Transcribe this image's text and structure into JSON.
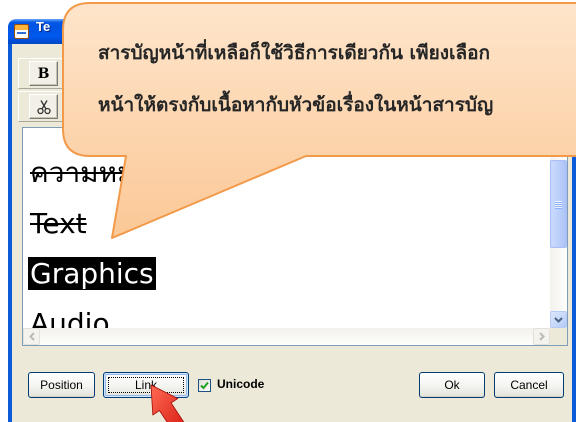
{
  "window": {
    "title": "Te"
  },
  "toolbar": {
    "bold_label": "B"
  },
  "list": {
    "items": [
      {
        "label": "ความหม",
        "struck": true,
        "selected": false
      },
      {
        "label": "Text",
        "struck": true,
        "selected": false
      },
      {
        "label": "Graphics",
        "struck": false,
        "selected": true
      },
      {
        "label": "Audio",
        "struck": false,
        "selected": false
      }
    ]
  },
  "buttons": {
    "position": "Position",
    "link": "Link",
    "ok": "Ok",
    "cancel": "Cancel"
  },
  "unicode": {
    "label": "Unicode",
    "checked": true
  },
  "callout": {
    "line1": "สารบัญหน้าที่เหลือก็ใช้วิธีการเดียวกัน เพียงเลือก",
    "line2": "หน้าให้ตรงกับเนื้อหากับหัวข้อเรื่องในหน้าสารบัญ"
  },
  "icons": {
    "app": "app-icon",
    "cut": "scissors-icon",
    "scroll_up": "chevron-up-icon",
    "scroll_down": "chevron-down-icon",
    "scroll_left": "chevron-left-icon",
    "scroll_right": "chevron-right-icon",
    "check": "checkmark-icon",
    "pointer": "red-arrow-icon"
  },
  "colors": {
    "title_bar": "#0055E5",
    "selection": "#000000",
    "callout_fill_top": "#FEE5CB",
    "callout_fill_bottom": "#FBC896",
    "callout_border": "#F29A4A",
    "arrow_light": "#FF6A55",
    "arrow_dark": "#D3140B",
    "check": "#21A121"
  }
}
